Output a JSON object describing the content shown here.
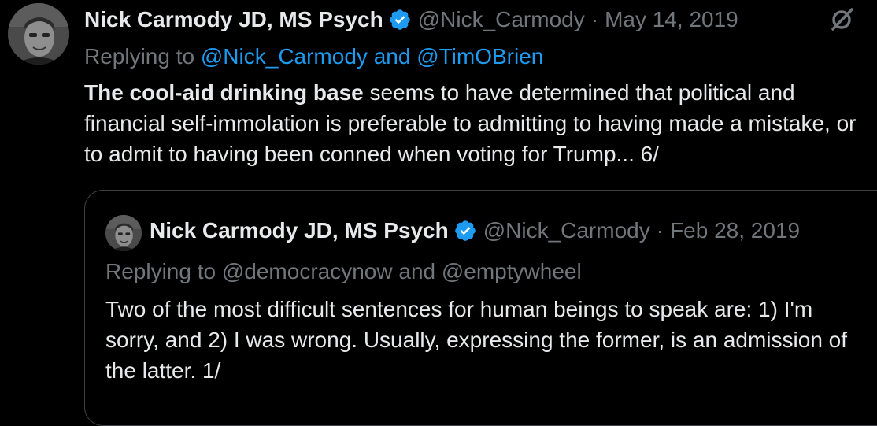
{
  "tweet": {
    "author_name": "Nick Carmody JD, MS Psych",
    "handle": "@Nick_Carmody",
    "separator": "·",
    "date": "May 14, 2019",
    "replying_prefix": "Replying to",
    "replying_to_1": "@Nick_Carmody",
    "replying_and": "and",
    "replying_to_2": "@TimOBrien",
    "body_bold": "The cool-aid drinking base",
    "body_rest": " seems to have determined that political and financial self-immolation is preferable to admitting to having made a mistake, or to admit to having been conned when voting for Trump... 6/"
  },
  "quoted_tweet": {
    "author_name": "Nick Carmody JD, MS Psych",
    "handle": "@Nick_Carmody",
    "separator": "·",
    "date": "Feb 28, 2019",
    "replying_line": "Replying to @democracynow and @emptywheel",
    "body": "Two of the most difficult sentences for human beings to speak are: 1) I'm sorry, and 2) I was wrong.  Usually, expressing the former, is an admission of the latter.  1/"
  },
  "icons": {
    "verified": "verified-badge-icon",
    "grok": "grok-icon"
  },
  "colors": {
    "background": "#000000",
    "text": "#e7e9ea",
    "muted": "#71767b",
    "link": "#1d9bf0",
    "verified": "#1d9bf0",
    "quote_border": "#3e4144"
  }
}
